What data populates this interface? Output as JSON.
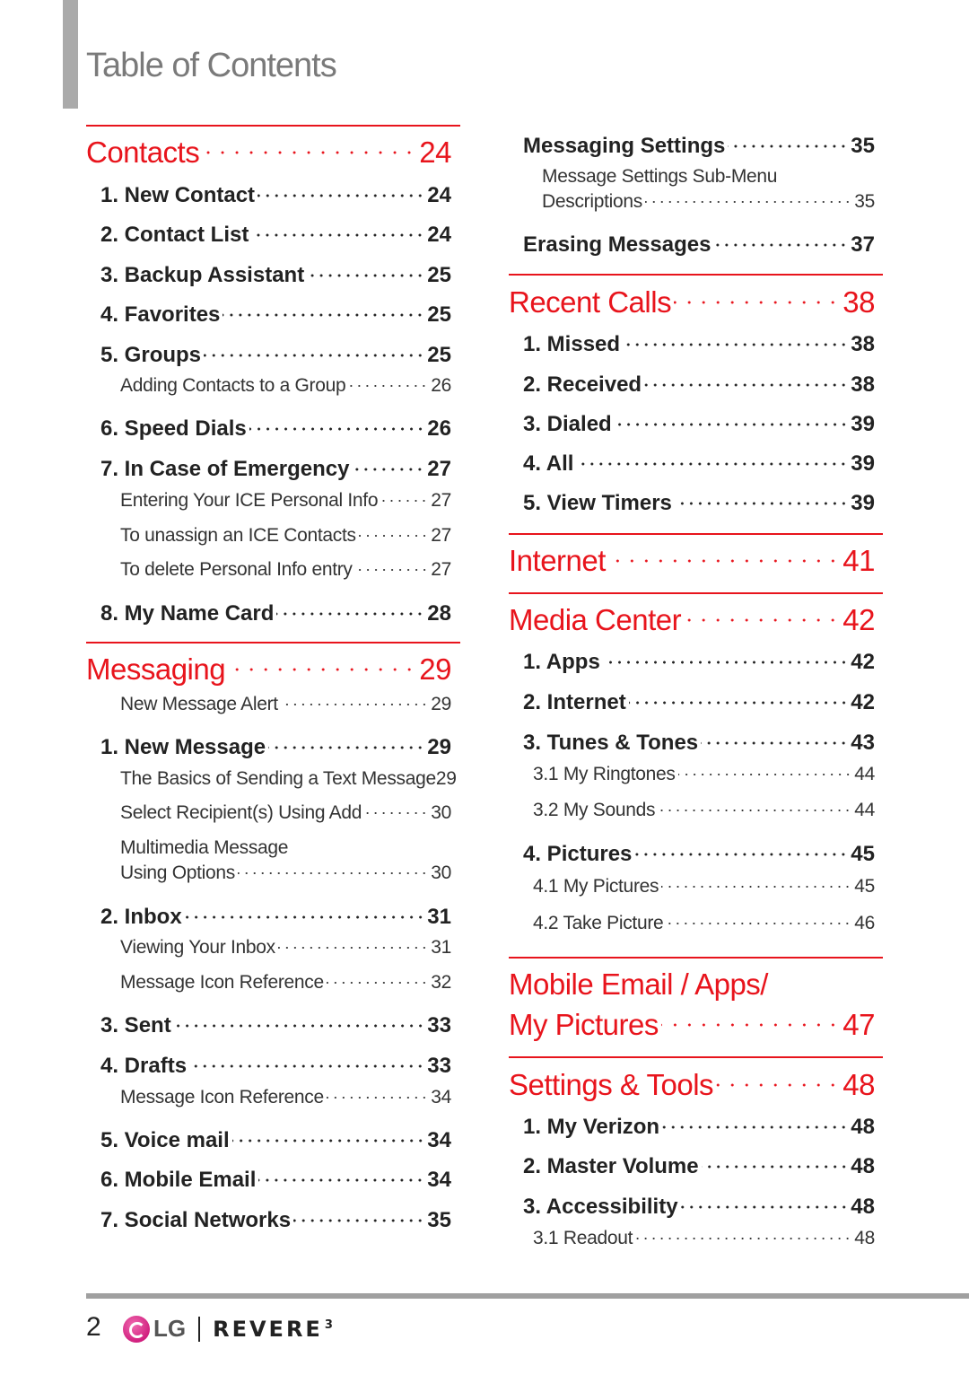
{
  "title": "Table of Contents",
  "footer": {
    "page_number": "2",
    "logo_brand": "LG",
    "product": "REVERE",
    "product_suffix": "3",
    "logo_color": "#c4006a"
  },
  "colors": {
    "accent": "#e8141c",
    "title_gray": "#7a7a7a",
    "bar_gray": "#aaaaaa"
  },
  "left": [
    {
      "t": "rule"
    },
    {
      "t": "section",
      "label": "Contacts",
      "page": "24"
    },
    {
      "t": "item",
      "label": "1. New Contact",
      "page": "24"
    },
    {
      "t": "item",
      "label": "2. Contact List",
      "page": "24"
    },
    {
      "t": "item",
      "label": "3. Backup Assistant",
      "page": "25"
    },
    {
      "t": "item",
      "label": "4. Favorites",
      "page": "25"
    },
    {
      "t": "item",
      "label": "5. Groups",
      "page": "25"
    },
    {
      "t": "sub",
      "label": "Adding Contacts to a Group",
      "page": "26"
    },
    {
      "t": "item",
      "label": "6. Speed Dials",
      "page": "26"
    },
    {
      "t": "item",
      "label": "7. In Case of Emergency",
      "page": "27"
    },
    {
      "t": "sub",
      "label": "Entering Your ICE Personal Info",
      "page": "27"
    },
    {
      "t": "sub",
      "label": "To unassign an ICE Contacts",
      "page": "27"
    },
    {
      "t": "sub",
      "label": "To delete Personal Info entry",
      "page": "27"
    },
    {
      "t": "item",
      "label": "8. My Name Card",
      "page": "28"
    },
    {
      "t": "rule"
    },
    {
      "t": "section",
      "label": "Messaging",
      "page": "29"
    },
    {
      "t": "sub",
      "label": "New Message Alert",
      "page": "29"
    },
    {
      "t": "item",
      "label": "1. New Message",
      "page": "29"
    },
    {
      "t": "sub",
      "label": "The Basics of Sending a Text Message",
      "page": "29",
      "nodots": true
    },
    {
      "t": "sub",
      "label": "Select Recipient(s) Using Add",
      "page": "30"
    },
    {
      "t": "sub",
      "label": "Multimedia Message",
      "page": "",
      "nodots": true
    },
    {
      "t": "sub",
      "label": "Using Options",
      "page": "30"
    },
    {
      "t": "item",
      "label": "2. Inbox",
      "page": "31"
    },
    {
      "t": "sub",
      "label": "Viewing Your Inbox",
      "page": "31"
    },
    {
      "t": "sub",
      "label": "Message Icon Reference",
      "page": "32"
    },
    {
      "t": "item",
      "label": "3. Sent",
      "page": "33"
    },
    {
      "t": "item",
      "label": "4. Drafts",
      "page": "33"
    },
    {
      "t": "sub",
      "label": "Message Icon Reference",
      "page": "34"
    },
    {
      "t": "item",
      "label": "5. Voice mail",
      "page": "34"
    },
    {
      "t": "item",
      "label": "6. Mobile Email",
      "page": "34"
    },
    {
      "t": "item",
      "label": "7. Social Networks",
      "page": "35"
    }
  ],
  "right": [
    {
      "t": "item",
      "label": "Messaging Settings",
      "page": "35"
    },
    {
      "t": "sub",
      "label": "Message Settings Sub-Menu",
      "page": "",
      "nodots": true
    },
    {
      "t": "sub",
      "label": "Descriptions",
      "page": "35"
    },
    {
      "t": "item",
      "label": "Erasing Messages",
      "page": "37"
    },
    {
      "t": "rule"
    },
    {
      "t": "section",
      "label": "Recent Calls",
      "page": "38"
    },
    {
      "t": "item",
      "label": "1. Missed",
      "page": "38"
    },
    {
      "t": "item",
      "label": "2. Received",
      "page": "38"
    },
    {
      "t": "item",
      "label": "3. Dialed",
      "page": "39"
    },
    {
      "t": "item",
      "label": "4. All",
      "page": "39"
    },
    {
      "t": "item",
      "label": "5. View Timers",
      "page": "39"
    },
    {
      "t": "rule"
    },
    {
      "t": "section",
      "label": "Internet",
      "page": "41"
    },
    {
      "t": "rule"
    },
    {
      "t": "section",
      "label": "Media Center",
      "page": "42"
    },
    {
      "t": "item",
      "label": "1. Apps",
      "page": "42"
    },
    {
      "t": "item",
      "label": "2. Internet",
      "page": "42"
    },
    {
      "t": "item",
      "label": "3. Tunes & Tones",
      "page": "43"
    },
    {
      "t": "sub",
      "label": "3.1 My Ringtones",
      "page": "44"
    },
    {
      "t": "sub",
      "label": "3.2 My Sounds",
      "page": "44"
    },
    {
      "t": "item",
      "label": "4. Pictures",
      "page": "45"
    },
    {
      "t": "sub",
      "label": "4.1 My Pictures",
      "page": "45"
    },
    {
      "t": "sub",
      "label": "4.2 Take Picture",
      "page": "46"
    },
    {
      "t": "rule"
    },
    {
      "t": "section",
      "label": "Mobile Email / Apps/",
      "page": "",
      "nodots": true
    },
    {
      "t": "section",
      "label": "My Pictures",
      "page": "47"
    },
    {
      "t": "rule"
    },
    {
      "t": "section",
      "label": "Settings & Tools",
      "page": "48"
    },
    {
      "t": "item",
      "label": "1. My Verizon",
      "page": "48"
    },
    {
      "t": "item",
      "label": "2. Master Volume",
      "page": "48"
    },
    {
      "t": "item",
      "label": "3. Accessibility",
      "page": "48"
    },
    {
      "t": "sub",
      "label": "3.1 Readout",
      "page": "48"
    }
  ]
}
